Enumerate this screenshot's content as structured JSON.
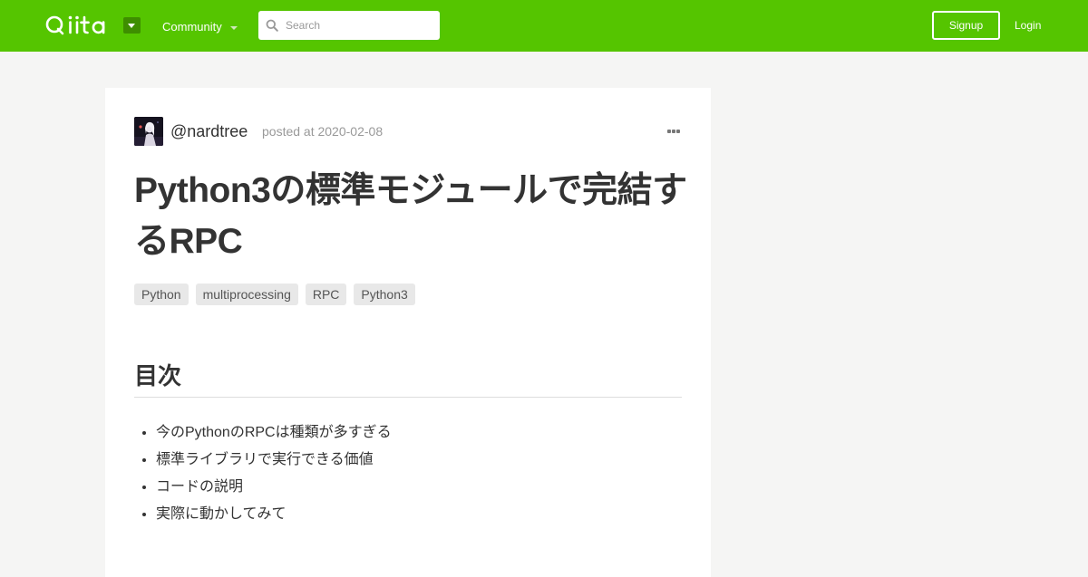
{
  "header": {
    "logo_text": "Qiita",
    "community_label": "Community",
    "search_placeholder": "Search",
    "signup_label": "Signup",
    "login_label": "Login",
    "colors": {
      "brand": "#55c500",
      "brand_dark": "#3e8e00"
    }
  },
  "article": {
    "author": "@nardtree",
    "posted": "posted at 2020-02-08",
    "title": "Python3の標準モジュールで完結するRPC",
    "tags": [
      "Python",
      "multiprocessing",
      "RPC",
      "Python3"
    ],
    "toc_heading": "目次",
    "toc_items": [
      "今のPythonのRPCは種類が多すぎる",
      "標準ライブラリで実行できる価値",
      "コードの説明",
      "実際に動かしてみて"
    ]
  },
  "icons": {
    "search": "search-icon",
    "more": "more-icon",
    "dropdown": "caret-down-icon"
  }
}
